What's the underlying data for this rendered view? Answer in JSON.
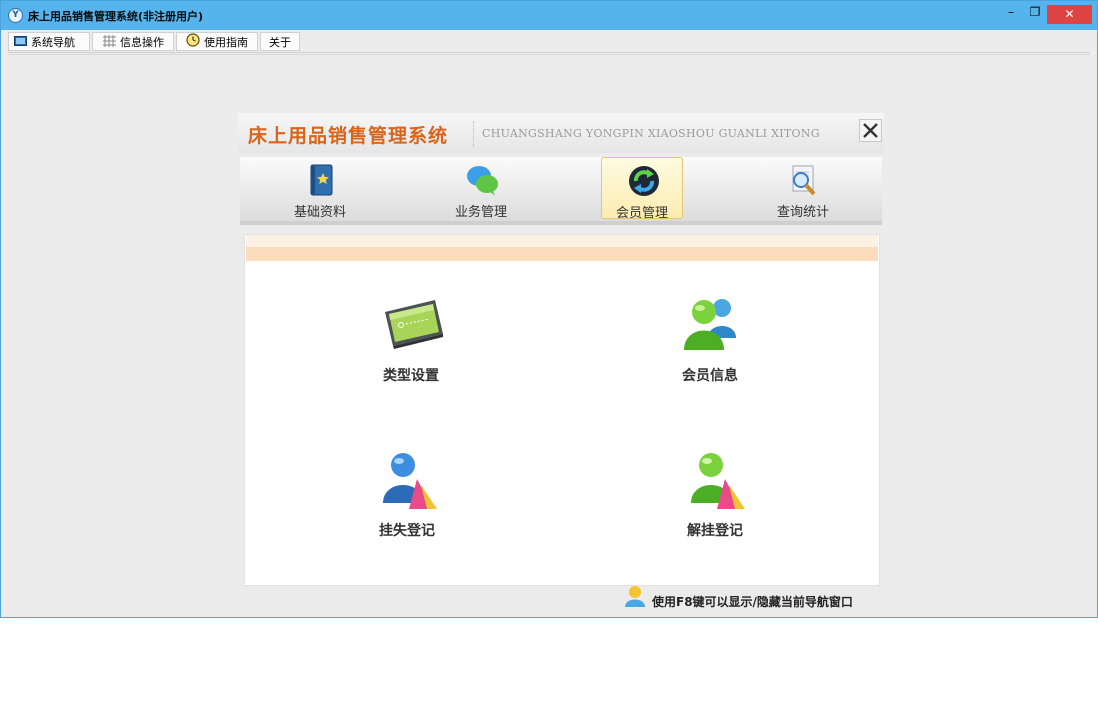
{
  "window": {
    "title": "床上用品销售管理系统(非注册用户)",
    "controls": {
      "minimize": "–",
      "restore": "❐",
      "close": "✕"
    }
  },
  "menubar": {
    "items": [
      {
        "label": "系统导航",
        "icon": "monitor-icon"
      },
      {
        "label": "信息操作",
        "icon": "grid-icon"
      },
      {
        "label": "使用指南",
        "icon": "clock-icon"
      },
      {
        "label": "关于",
        "icon": ""
      }
    ]
  },
  "nav": {
    "title_cn": "床上用品销售管理系统",
    "title_en": "CHUANGSHANG YONGPIN XIAOSHOU GUANLI XITONG",
    "close_icon": "close-icon",
    "tabs": [
      {
        "label": "基础资料",
        "icon": "book-star-icon"
      },
      {
        "label": "业务管理",
        "icon": "chat-bubbles-icon"
      },
      {
        "label": "会员管理",
        "icon": "sync-arrows-icon",
        "active": true
      },
      {
        "label": "查询统计",
        "icon": "magnifier-doc-icon"
      }
    ],
    "functions": [
      {
        "label": "类型设置",
        "icon": "device-screen-icon"
      },
      {
        "label": "会员信息",
        "icon": "users-icon"
      },
      {
        "label": "挂失登记",
        "icon": "user-blue-icon"
      },
      {
        "label": "解挂登记",
        "icon": "user-green-icon"
      }
    ],
    "hint": "使用F8键可以显示/隐藏当前导航窗口"
  },
  "colors": {
    "titlebar": "#55b4ec",
    "close_button": "#e04343",
    "brand_orange": "#d9641a",
    "active_tab": "#fbecb0",
    "band": "#fbdcbd"
  }
}
